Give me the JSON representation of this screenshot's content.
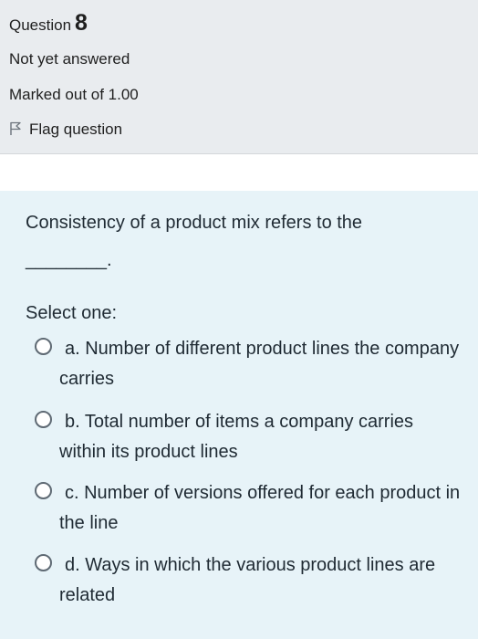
{
  "info": {
    "question_label": "Question",
    "question_number": "8",
    "status": "Not yet answered",
    "grade": "Marked out of 1.00",
    "flag_label": "Flag question"
  },
  "question": {
    "text": "Consistency of a product mix refers to the",
    "blank": "________."
  },
  "prompt": "Select one:",
  "answers": [
    {
      "label": "a. Number of different product lines the company carries"
    },
    {
      "label": "b. Total number of items a company carries within its product lines"
    },
    {
      "label": "c. Number of versions offered for each product in the line"
    },
    {
      "label": "d. Ways in which the various product lines are related"
    }
  ],
  "colors": {
    "info_background": "#e9ecef",
    "content_background": "#e7f3f8"
  },
  "icons": {
    "flag": "flag-icon",
    "radio": "radio-unselected-icon"
  }
}
